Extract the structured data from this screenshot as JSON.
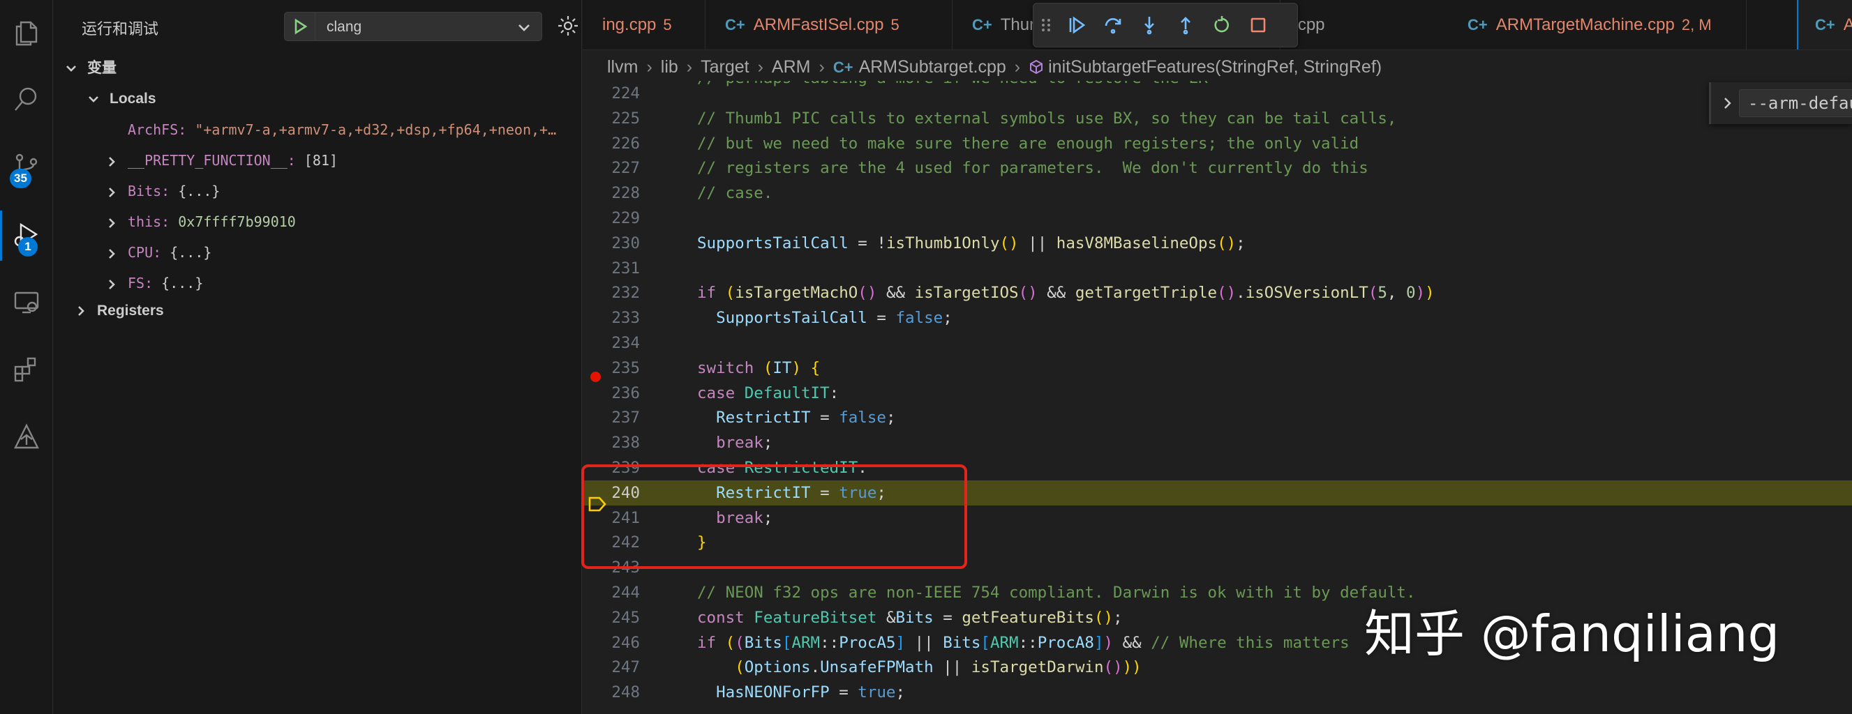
{
  "activity_bar": {
    "items": [
      {
        "icon": "files-icon"
      },
      {
        "icon": "search-icon"
      },
      {
        "icon": "source-control-icon",
        "badge": "35"
      },
      {
        "icon": "run-debug-icon",
        "badge": "1"
      },
      {
        "icon": "remote-explorer-icon"
      },
      {
        "icon": "extensions-icon"
      },
      {
        "icon": "accounts-deploy-icon"
      }
    ]
  },
  "sidebar": {
    "title": "运行和调试",
    "launch_config": "clang",
    "variables_label": "变量",
    "locals_label": "Locals",
    "registers_label": "Registers",
    "locals": [
      {
        "name": "ArchFS:",
        "value": "\"+armv7-a,+armv7-a,+d32,+dsp,+fp64,+neon,+…",
        "expandable": false,
        "kind": "str"
      },
      {
        "name": "__PRETTY_FUNCTION__:",
        "value": "[81]",
        "expandable": true,
        "kind": "plain"
      },
      {
        "name": "Bits:",
        "value": "{...}",
        "expandable": true,
        "kind": "plain"
      },
      {
        "name": "this:",
        "value": "0x7ffff7b99010",
        "expandable": true,
        "kind": "num"
      },
      {
        "name": "CPU:",
        "value": "{...}",
        "expandable": true,
        "kind": "plain"
      },
      {
        "name": "FS:",
        "value": "{...}",
        "expandable": true,
        "kind": "plain"
      }
    ]
  },
  "tabs": [
    {
      "name": "ing.cpp",
      "count": "5",
      "plain": false
    },
    {
      "name": "ARMFastISel.cpp",
      "count": "5",
      "plain": false
    },
    {
      "name": "Thur",
      "count": "",
      "plain": true
    },
    {
      "name": "MipsOs16.cpp",
      "count": "",
      "plain": true
    },
    {
      "name": "ARMTargetMachine.cpp",
      "count": "2, M",
      "plain": false
    },
    {
      "name": "A",
      "count": "",
      "plain": false
    }
  ],
  "debug_toolbar": [
    "drag-handle-icon",
    "continue-icon",
    "step-over-icon",
    "step-into-icon",
    "step-out-icon",
    "restart-icon",
    "stop-icon"
  ],
  "breadcrumb": {
    "parts": [
      "llvm",
      "lib",
      "Target",
      "ARM",
      "ARMSubtarget.cpp",
      "initSubtargetFeatures(StringRef, StringRef)"
    ]
  },
  "find_widget": {
    "value": "--arm-defau"
  },
  "editor": {
    "breakpoint_line": "235",
    "current_line": "240",
    "top_partial_line": "// perhaps tabling a more if we need to restore the LR",
    "lines": [
      {
        "n": "224",
        "text": ""
      },
      {
        "n": "225",
        "text": "// Thumb1 PIC calls to external symbols use BX, so they can be tail calls,"
      },
      {
        "n": "226",
        "text": "// but we need to make sure there are enough registers; the only valid"
      },
      {
        "n": "227",
        "text": "// registers are the 4 used for parameters.  We don't currently do this"
      },
      {
        "n": "228",
        "text": "// case."
      },
      {
        "n": "229",
        "text": ""
      },
      {
        "n": "230",
        "text": "SupportsTailCall = !isThumb1Only() || hasV8MBaselineOps();"
      },
      {
        "n": "231",
        "text": ""
      },
      {
        "n": "232",
        "text": "if (isTargetMachO() && isTargetIOS() && getTargetTriple().isOSVersionLT(5, 0))"
      },
      {
        "n": "233",
        "text": "  SupportsTailCall = false;"
      },
      {
        "n": "234",
        "text": ""
      },
      {
        "n": "235",
        "text": "switch (IT) {"
      },
      {
        "n": "236",
        "text": "case DefaultIT:"
      },
      {
        "n": "237",
        "text": "  RestrictIT = false;"
      },
      {
        "n": "238",
        "text": "  break;"
      },
      {
        "n": "239",
        "text": "case RestrictedIT:"
      },
      {
        "n": "240",
        "text": "  RestrictIT = true;"
      },
      {
        "n": "241",
        "text": "  break;"
      },
      {
        "n": "242",
        "text": "}"
      },
      {
        "n": "243",
        "text": ""
      },
      {
        "n": "244",
        "text": "// NEON f32 ops are non-IEEE 754 compliant. Darwin is ok with it by default."
      },
      {
        "n": "245",
        "text": "const FeatureBitset &Bits = getFeatureBits();"
      },
      {
        "n": "246",
        "text": "if ((Bits[ARM::ProcA5] || Bits[ARM::ProcA8]) && // Where this matters"
      },
      {
        "n": "247",
        "text": "    (Options.UnsafeFPMath || isTargetDarwin()))"
      },
      {
        "n": "248",
        "text": "  HasNEONForFP = true;"
      }
    ]
  },
  "watermark": "知乎 @fanqiliang",
  "colors": {
    "accent": "#0078d4",
    "highlight_line": "#4b4b18",
    "breakpoint": "#e51400",
    "annotation_box": "#e1251b",
    "tab_modified": "#e2866c"
  }
}
